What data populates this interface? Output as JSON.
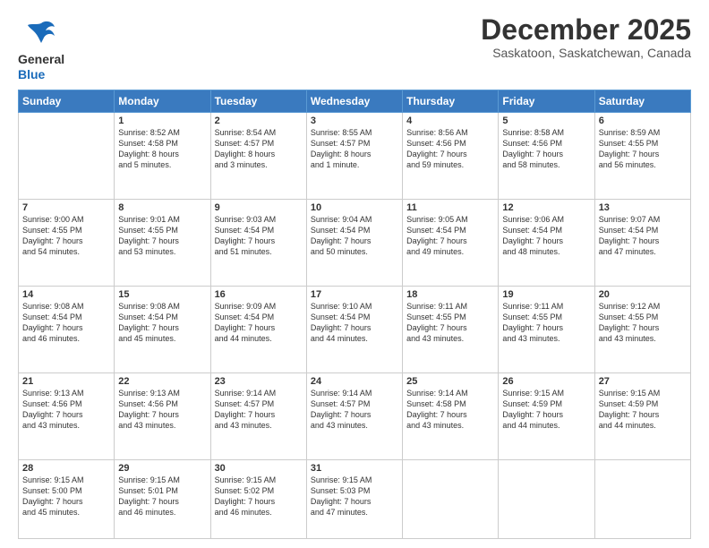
{
  "logo": {
    "line1": "General",
    "line2": "Blue"
  },
  "title": "December 2025",
  "subtitle": "Saskatoon, Saskatchewan, Canada",
  "days_header": [
    "Sunday",
    "Monday",
    "Tuesday",
    "Wednesday",
    "Thursday",
    "Friday",
    "Saturday"
  ],
  "weeks": [
    [
      {
        "day": "",
        "info": ""
      },
      {
        "day": "1",
        "info": "Sunrise: 8:52 AM\nSunset: 4:58 PM\nDaylight: 8 hours\nand 5 minutes."
      },
      {
        "day": "2",
        "info": "Sunrise: 8:54 AM\nSunset: 4:57 PM\nDaylight: 8 hours\nand 3 minutes."
      },
      {
        "day": "3",
        "info": "Sunrise: 8:55 AM\nSunset: 4:57 PM\nDaylight: 8 hours\nand 1 minute."
      },
      {
        "day": "4",
        "info": "Sunrise: 8:56 AM\nSunset: 4:56 PM\nDaylight: 7 hours\nand 59 minutes."
      },
      {
        "day": "5",
        "info": "Sunrise: 8:58 AM\nSunset: 4:56 PM\nDaylight: 7 hours\nand 58 minutes."
      },
      {
        "day": "6",
        "info": "Sunrise: 8:59 AM\nSunset: 4:55 PM\nDaylight: 7 hours\nand 56 minutes."
      }
    ],
    [
      {
        "day": "7",
        "info": "Sunrise: 9:00 AM\nSunset: 4:55 PM\nDaylight: 7 hours\nand 54 minutes."
      },
      {
        "day": "8",
        "info": "Sunrise: 9:01 AM\nSunset: 4:55 PM\nDaylight: 7 hours\nand 53 minutes."
      },
      {
        "day": "9",
        "info": "Sunrise: 9:03 AM\nSunset: 4:54 PM\nDaylight: 7 hours\nand 51 minutes."
      },
      {
        "day": "10",
        "info": "Sunrise: 9:04 AM\nSunset: 4:54 PM\nDaylight: 7 hours\nand 50 minutes."
      },
      {
        "day": "11",
        "info": "Sunrise: 9:05 AM\nSunset: 4:54 PM\nDaylight: 7 hours\nand 49 minutes."
      },
      {
        "day": "12",
        "info": "Sunrise: 9:06 AM\nSunset: 4:54 PM\nDaylight: 7 hours\nand 48 minutes."
      },
      {
        "day": "13",
        "info": "Sunrise: 9:07 AM\nSunset: 4:54 PM\nDaylight: 7 hours\nand 47 minutes."
      }
    ],
    [
      {
        "day": "14",
        "info": "Sunrise: 9:08 AM\nSunset: 4:54 PM\nDaylight: 7 hours\nand 46 minutes."
      },
      {
        "day": "15",
        "info": "Sunrise: 9:08 AM\nSunset: 4:54 PM\nDaylight: 7 hours\nand 45 minutes."
      },
      {
        "day": "16",
        "info": "Sunrise: 9:09 AM\nSunset: 4:54 PM\nDaylight: 7 hours\nand 44 minutes."
      },
      {
        "day": "17",
        "info": "Sunrise: 9:10 AM\nSunset: 4:54 PM\nDaylight: 7 hours\nand 44 minutes."
      },
      {
        "day": "18",
        "info": "Sunrise: 9:11 AM\nSunset: 4:55 PM\nDaylight: 7 hours\nand 43 minutes."
      },
      {
        "day": "19",
        "info": "Sunrise: 9:11 AM\nSunset: 4:55 PM\nDaylight: 7 hours\nand 43 minutes."
      },
      {
        "day": "20",
        "info": "Sunrise: 9:12 AM\nSunset: 4:55 PM\nDaylight: 7 hours\nand 43 minutes."
      }
    ],
    [
      {
        "day": "21",
        "info": "Sunrise: 9:13 AM\nSunset: 4:56 PM\nDaylight: 7 hours\nand 43 minutes."
      },
      {
        "day": "22",
        "info": "Sunrise: 9:13 AM\nSunset: 4:56 PM\nDaylight: 7 hours\nand 43 minutes."
      },
      {
        "day": "23",
        "info": "Sunrise: 9:14 AM\nSunset: 4:57 PM\nDaylight: 7 hours\nand 43 minutes."
      },
      {
        "day": "24",
        "info": "Sunrise: 9:14 AM\nSunset: 4:57 PM\nDaylight: 7 hours\nand 43 minutes."
      },
      {
        "day": "25",
        "info": "Sunrise: 9:14 AM\nSunset: 4:58 PM\nDaylight: 7 hours\nand 43 minutes."
      },
      {
        "day": "26",
        "info": "Sunrise: 9:15 AM\nSunset: 4:59 PM\nDaylight: 7 hours\nand 44 minutes."
      },
      {
        "day": "27",
        "info": "Sunrise: 9:15 AM\nSunset: 4:59 PM\nDaylight: 7 hours\nand 44 minutes."
      }
    ],
    [
      {
        "day": "28",
        "info": "Sunrise: 9:15 AM\nSunset: 5:00 PM\nDaylight: 7 hours\nand 45 minutes."
      },
      {
        "day": "29",
        "info": "Sunrise: 9:15 AM\nSunset: 5:01 PM\nDaylight: 7 hours\nand 46 minutes."
      },
      {
        "day": "30",
        "info": "Sunrise: 9:15 AM\nSunset: 5:02 PM\nDaylight: 7 hours\nand 46 minutes."
      },
      {
        "day": "31",
        "info": "Sunrise: 9:15 AM\nSunset: 5:03 PM\nDaylight: 7 hours\nand 47 minutes."
      },
      {
        "day": "",
        "info": ""
      },
      {
        "day": "",
        "info": ""
      },
      {
        "day": "",
        "info": ""
      }
    ]
  ]
}
